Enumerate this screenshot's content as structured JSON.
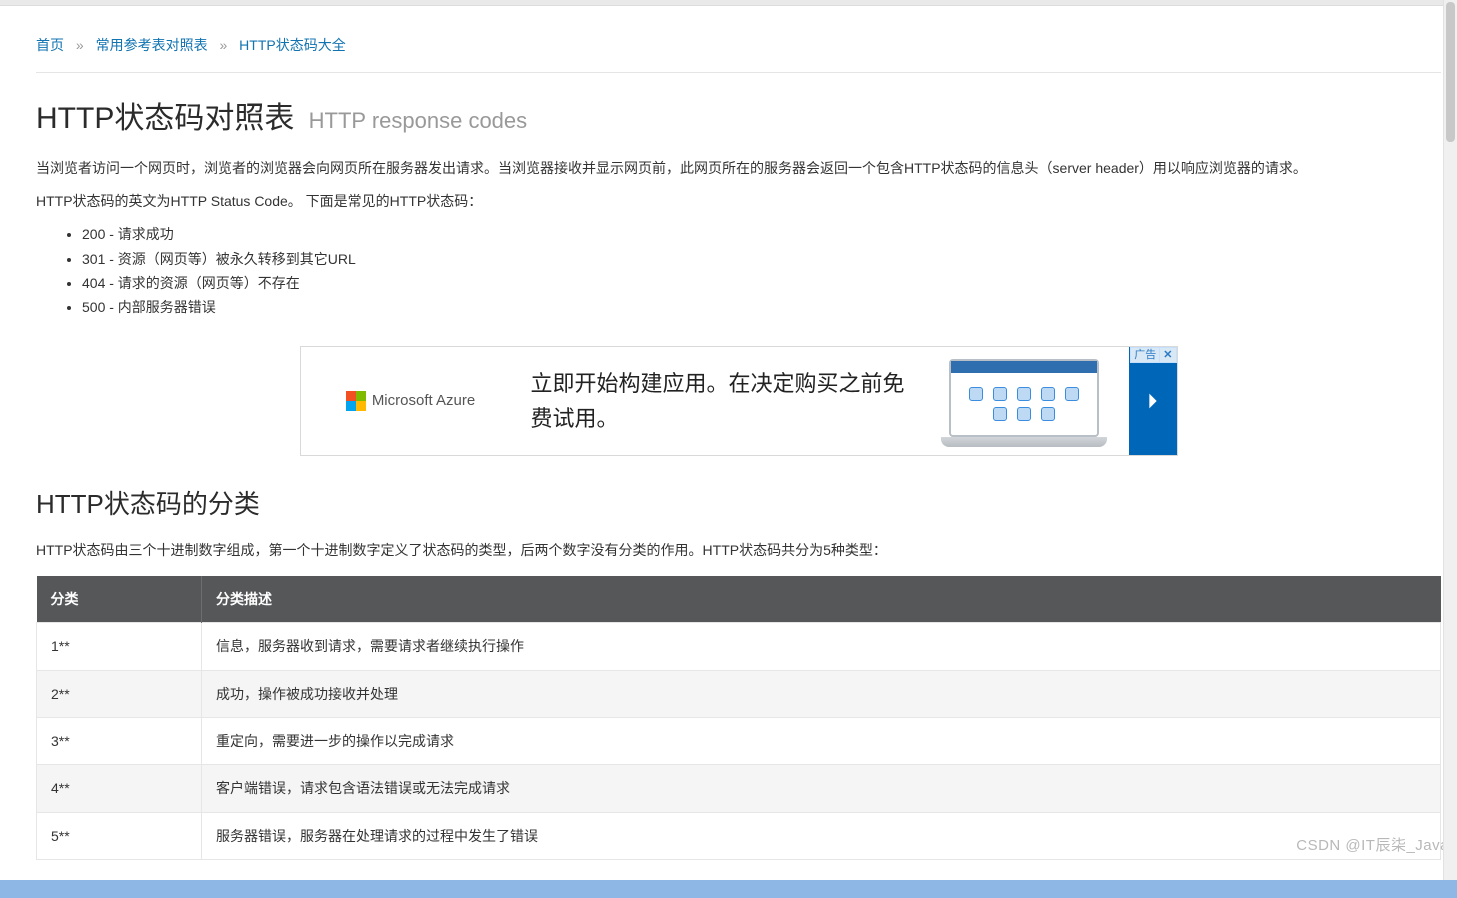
{
  "breadcrumb": {
    "home": "首页",
    "mid": "常用参考表对照表",
    "current": "HTTP状态码大全",
    "sep": "»"
  },
  "heading": {
    "title": "HTTP状态码对照表",
    "subtitle": "HTTP response codes"
  },
  "intro": {
    "p1": "当浏览者访问一个网页时，浏览者的浏览器会向网页所在服务器发出请求。当浏览器接收并显示网页前，此网页所在的服务器会返回一个包含HTTP状态码的信息头（server header）用以响应浏览器的请求。",
    "p2": "HTTP状态码的英文为HTTP Status Code。 下面是常见的HTTP状态码："
  },
  "common_codes": [
    "200 - 请求成功",
    "301 - 资源（网页等）被永久转移到其它URL",
    "404 - 请求的资源（网页等）不存在",
    "500 - 内部服务器错误"
  ],
  "ad": {
    "brand": "Microsoft Azure",
    "text": "立即开始构建应用。在决定购买之前免费试用。",
    "corner_label": "广告",
    "corner_close": "✕"
  },
  "section2": {
    "title": "HTTP状态码的分类",
    "intro": "HTTP状态码由三个十进制数字组成，第一个十进制数字定义了状态码的类型，后两个数字没有分类的作用。HTTP状态码共分为5种类型："
  },
  "table": {
    "headers": {
      "c1": "分类",
      "c2": "分类描述"
    },
    "rows": [
      {
        "c1": "1**",
        "c2": "信息，服务器收到请求，需要请求者继续执行操作"
      },
      {
        "c1": "2**",
        "c2": "成功，操作被成功接收并处理"
      },
      {
        "c1": "3**",
        "c2": "重定向，需要进一步的操作以完成请求"
      },
      {
        "c1": "4**",
        "c2": "客户端错误，请求包含语法错误或无法完成请求"
      },
      {
        "c1": "5**",
        "c2": "服务器错误，服务器在处理请求的过程中发生了错误"
      }
    ]
  },
  "watermark": "CSDN @IT辰柒_Java"
}
